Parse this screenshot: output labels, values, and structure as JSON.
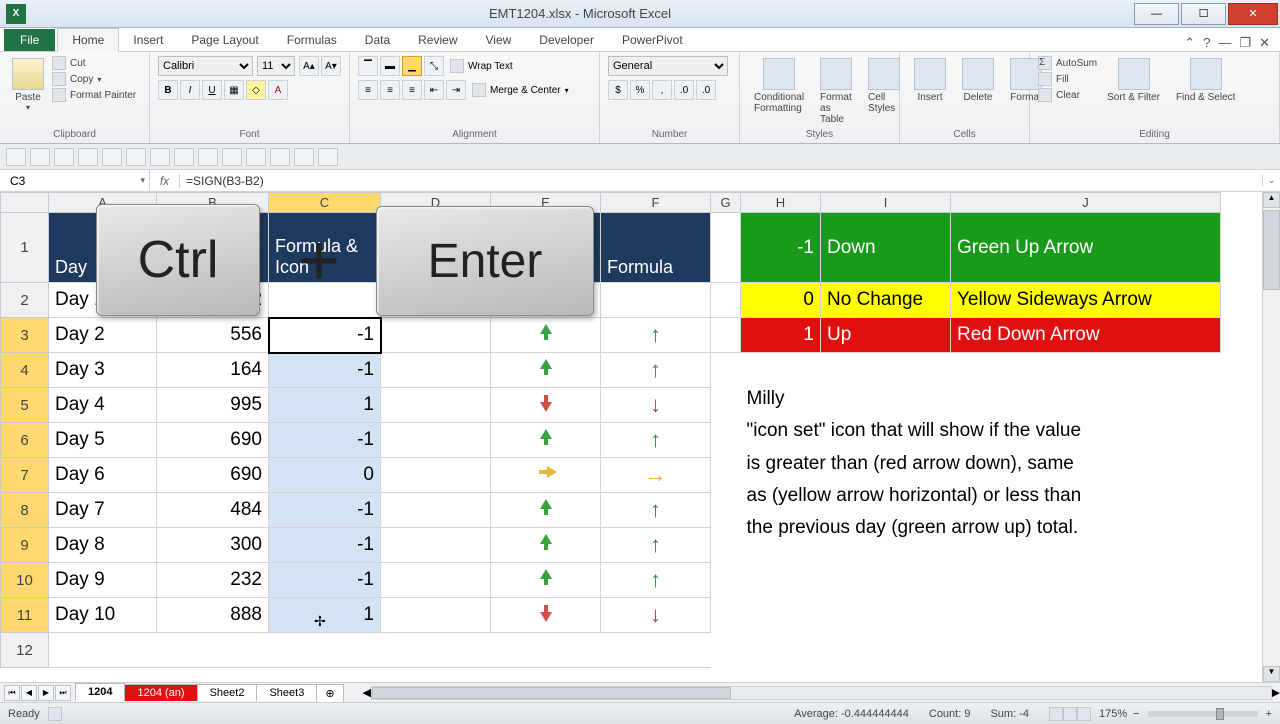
{
  "window": {
    "title": "EMT1204.xlsx - Microsoft Excel"
  },
  "tabs": {
    "file": "File",
    "home": "Home",
    "insert": "Insert",
    "pagelayout": "Page Layout",
    "formulas": "Formulas",
    "data": "Data",
    "review": "Review",
    "view": "View",
    "developer": "Developer",
    "powerpivot": "PowerPivot"
  },
  "ribbon": {
    "clipboard": {
      "label": "Clipboard",
      "paste": "Paste",
      "cut": "Cut",
      "copy": "Copy",
      "format_painter": "Format Painter"
    },
    "font": {
      "label": "Font",
      "family": "Calibri",
      "size": "11"
    },
    "alignment": {
      "label": "Alignment",
      "wrap": "Wrap Text",
      "merge": "Merge & Center"
    },
    "number": {
      "label": "Number",
      "format": "General"
    },
    "styles": {
      "label": "Styles",
      "cond": "Conditional Formatting",
      "table": "Format as Table",
      "cell": "Cell Styles"
    },
    "cells": {
      "label": "Cells",
      "insert": "Insert",
      "delete": "Delete",
      "format": "Format"
    },
    "editing": {
      "label": "Editing",
      "autosum": "AutoSum",
      "fill": "Fill",
      "clear": "Clear",
      "sort": "Sort & Filter",
      "find": "Find & Select"
    }
  },
  "namebox": "C3",
  "formula": "=SIGN(B3-B2)",
  "cols": {
    "A": "A",
    "B": "B",
    "C": "C",
    "D": "D",
    "E": "E",
    "F": "F",
    "G": "G",
    "H": "H",
    "I": "I",
    "J": "J"
  },
  "headers": {
    "day": "Day",
    "sales": "",
    "formula_icon": "Formula & Icon",
    "icon": "",
    "formula": "Formula"
  },
  "rows": [
    {
      "r": "2",
      "day": "Day 1",
      "sales": "1182",
      "c": "",
      "e": "",
      "f": ""
    },
    {
      "r": "3",
      "day": "Day 2",
      "sales": "556",
      "c": "-1",
      "e": "up",
      "f": "up"
    },
    {
      "r": "4",
      "day": "Day 3",
      "sales": "164",
      "c": "-1",
      "e": "up",
      "f": "up"
    },
    {
      "r": "5",
      "day": "Day 4",
      "sales": "995",
      "c": "1",
      "e": "down",
      "f": "down"
    },
    {
      "r": "6",
      "day": "Day 5",
      "sales": "690",
      "c": "-1",
      "e": "up",
      "f": "up"
    },
    {
      "r": "7",
      "day": "Day 6",
      "sales": "690",
      "c": "0",
      "e": "side",
      "f": "side"
    },
    {
      "r": "8",
      "day": "Day 7",
      "sales": "484",
      "c": "-1",
      "e": "up",
      "f": "up"
    },
    {
      "r": "9",
      "day": "Day 8",
      "sales": "300",
      "c": "-1",
      "e": "up",
      "f": "up"
    },
    {
      "r": "10",
      "day": "Day 9",
      "sales": "232",
      "c": "-1",
      "e": "up",
      "f": "up"
    },
    {
      "r": "11",
      "day": "Day 10",
      "sales": "888",
      "c": "1",
      "e": "down",
      "f": "down"
    }
  ],
  "legend": [
    {
      "n": "-1",
      "label": "Down",
      "desc": "Green Up Arrow"
    },
    {
      "n": "0",
      "label": "No Change",
      "desc": "Yellow Sideways Arrow"
    },
    {
      "n": "1",
      "label": "Up",
      "desc": "Red Down Arrow"
    }
  ],
  "note": {
    "name": "Milly",
    "line1": "\"icon set\" icon that will show if the value",
    "line2": "is greater than (red arrow down), same",
    "line3": "as (yellow arrow horizontal) or less than",
    "line4": "the previous day (green arrow up) total."
  },
  "keycaps": {
    "ctrl": "Ctrl",
    "plus": "+",
    "enter": "Enter"
  },
  "sheets": {
    "s1": "1204",
    "s2": "1204 (an)",
    "s3": "Sheet2",
    "s4": "Sheet3"
  },
  "status": {
    "ready": "Ready",
    "average": "Average: -0.444444444",
    "count": "Count: 9",
    "sum": "Sum: -4",
    "zoom": "175%"
  }
}
